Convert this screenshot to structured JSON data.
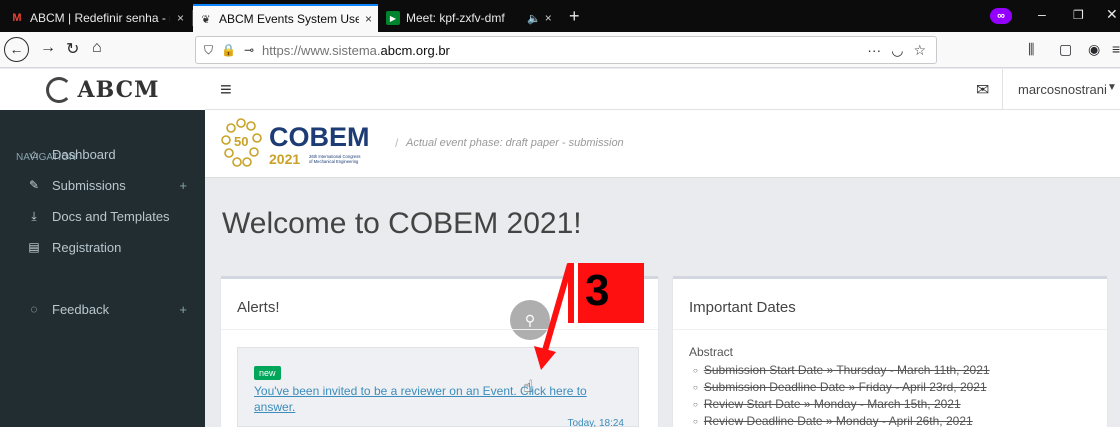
{
  "browser": {
    "tabs": [
      {
        "title": "ABCM | Redefinir senha - marc",
        "favicon": "gmail-icon",
        "close": "×",
        "active": false
      },
      {
        "title": "ABCM Events System Users",
        "favicon": "abcm-favicon",
        "close": "×",
        "active": true
      },
      {
        "title": "Meet: kpf-zxfv-dmf",
        "favicon": "meet-icon",
        "close": "×",
        "audio": "🔈",
        "active": false
      }
    ],
    "new_tab": "+",
    "url_prefix": "https://www.sistema.",
    "url_domain": "abcm.org.br",
    "url_more": "···",
    "window_controls": [
      "–",
      "❐",
      "✕"
    ]
  },
  "app": {
    "logo_text": "ABCM",
    "user_name": "marcosnostrani",
    "event_phase": "Actual event phase: draft paper - submission",
    "cobem_logo": {
      "main": "COBEM",
      "year": "2021",
      "anniversary": "50",
      "subtitle_line1": "26th International Congress",
      "subtitle_line2": "of Mechanical Engineering"
    }
  },
  "sidebar": {
    "heading": "NAVIGATION",
    "items": [
      {
        "label": "Dashboard",
        "icon": "home-icon",
        "glyph": "⌂"
      },
      {
        "label": "Submissions",
        "icon": "pencil-icon",
        "glyph": "✎",
        "plus": "+"
      },
      {
        "label": "Docs and Templates",
        "icon": "download-icon",
        "glyph": "⤓"
      },
      {
        "label": "Registration",
        "icon": "document-icon",
        "glyph": "▤"
      },
      {
        "label": "Feedback",
        "icon": "chat-icon",
        "glyph": "◌",
        "plus": "+"
      }
    ]
  },
  "main": {
    "welcome": "Welcome to COBEM 2021!",
    "alerts": {
      "title": "Alerts!",
      "card": {
        "badge": "new",
        "text": "You've been invited to be a reviewer on an Event. Click here to answer.",
        "time": "Today, 18:24"
      }
    },
    "dates": {
      "title": "Important Dates",
      "group": "Abstract",
      "items": [
        "Submission Start Date » Thursday - March 11th, 2021",
        "Submission Deadline Date » Friday - April 23rd, 2021",
        "Review Start Date » Monday - March 15th, 2021",
        "Review Deadline Date » Monday - April 26th, 2021"
      ]
    }
  },
  "annotation": {
    "step_number": "3",
    "color": "#ff1010"
  },
  "colors": {
    "sidebar_bg": "#222d32",
    "link": "#3c8dbc",
    "badge_green": "#00a65a",
    "firefox_accent": "#0a84ff"
  }
}
